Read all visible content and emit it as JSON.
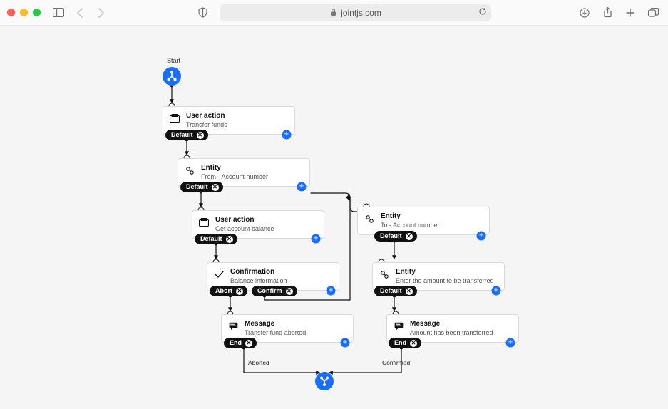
{
  "browser": {
    "url_host": "jointjs.com"
  },
  "diagram": {
    "start_label": "Start",
    "nodes": {
      "n1": {
        "title": "User action",
        "sub": "Transfer funds"
      },
      "n2": {
        "title": "Entity",
        "sub": "From - Account number"
      },
      "n3": {
        "title": "User action",
        "sub": "Get account balance"
      },
      "n4": {
        "title": "Confirmation",
        "sub": "Balance information"
      },
      "n5": {
        "title": "Message",
        "sub": "Transfer fund aborted"
      },
      "n6": {
        "title": "Entity",
        "sub": "To - Account number"
      },
      "n7": {
        "title": "Entity",
        "sub": "Enter the amount to be transferred"
      },
      "n8": {
        "title": "Message",
        "sub": "Amount has been transferred"
      }
    },
    "pills": {
      "default": "Default",
      "abort": "Abort",
      "confirm": "Confirm",
      "end": "End"
    },
    "edge_labels": {
      "aborted": "Aborted",
      "confirmed": "Confirmed"
    }
  }
}
